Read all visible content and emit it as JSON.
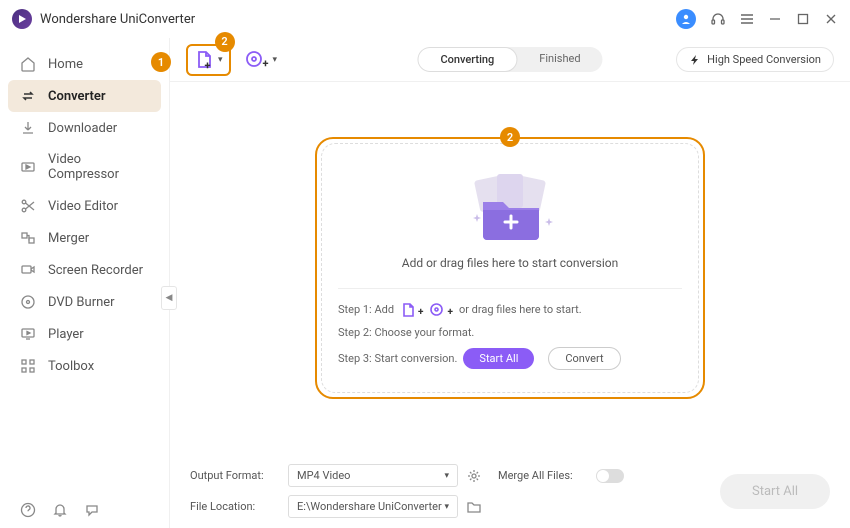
{
  "app": {
    "title": "Wondershare UniConverter"
  },
  "sidebar": {
    "items": [
      {
        "label": "Home"
      },
      {
        "label": "Converter"
      },
      {
        "label": "Downloader"
      },
      {
        "label": "Video Compressor"
      },
      {
        "label": "Video Editor"
      },
      {
        "label": "Merger"
      },
      {
        "label": "Screen Recorder"
      },
      {
        "label": "DVD Burner"
      },
      {
        "label": "Player"
      },
      {
        "label": "Toolbox"
      }
    ]
  },
  "toolbar": {
    "tabs": {
      "converting": "Converting",
      "finished": "Finished"
    },
    "high_speed": "High Speed Conversion"
  },
  "dropzone": {
    "headline": "Add or drag files here to start conversion",
    "step1_a": "Step 1: Add",
    "step1_b": "or drag files here to start.",
    "step2": "Step 2: Choose your format.",
    "step3": "Step 3: Start conversion.",
    "start_all": "Start All",
    "convert": "Convert"
  },
  "footer": {
    "output_format_label": "Output Format:",
    "output_format_value": "MP4 Video",
    "merge_label": "Merge All Files:",
    "file_location_label": "File Location:",
    "file_location_value": "E:\\Wondershare UniConverter",
    "start_all": "Start All"
  },
  "badges": {
    "one": "1",
    "two_a": "2",
    "two_b": "2"
  }
}
